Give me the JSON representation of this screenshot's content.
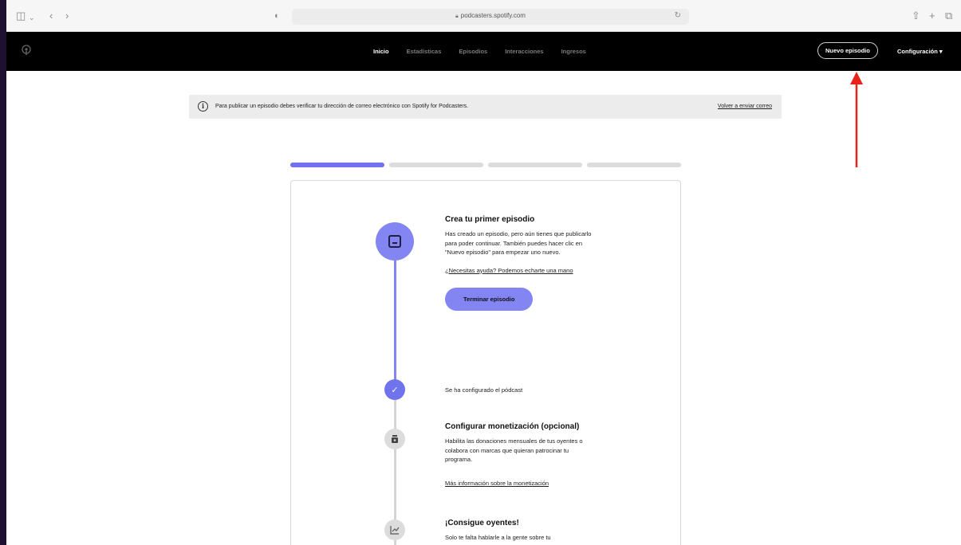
{
  "browser": {
    "url": "podcasters.spotify.com",
    "icons": [
      "sidebar-icon",
      "chevron-down-icon",
      "back-icon",
      "forward-icon",
      "shield-icon",
      "lock-icon",
      "reload-icon",
      "share-icon",
      "new-tab-icon",
      "tabs-icon"
    ]
  },
  "nav": {
    "links": [
      {
        "label": "Inicio",
        "active": true
      },
      {
        "label": "Estadísticas",
        "active": false
      },
      {
        "label": "Episodios",
        "active": false
      },
      {
        "label": "Interacciones",
        "active": false
      },
      {
        "label": "Ingresos",
        "active": false
      }
    ],
    "new_episode": "Nuevo episodio",
    "settings": "Configuración ▾"
  },
  "banner": {
    "text": "Para publicar un episodio debes verificar tu dirección de correo electrónico con Spotify for Podcasters.",
    "link": "Volver a enviar correo"
  },
  "progress": {
    "segments": 4,
    "completed": 1
  },
  "steps": {
    "first_episode": {
      "title": "Crea tu primer episodio",
      "body": "Has creado un episodio, pero aún tienes que publicarlo para poder continuar. También puedes hacer clic en \"Nuevo episodio\" para empezar uno nuevo.",
      "help": "¿Necesitas ayuda? Podemos echarte una mano",
      "cta": "Terminar episodio"
    },
    "configured": {
      "text": "Se ha configurado el pódcast"
    },
    "monetization": {
      "title": "Configurar monetización (opcional)",
      "body": "Habilita las donaciones mensuales de tus oyentes o colabora con marcas que quieran patrocinar tu programa.",
      "link": "Más información sobre la monetización"
    },
    "listeners": {
      "title": "¡Consigue oyentes!",
      "body": "Solo te falta hablarle a la gente sobre tu"
    }
  },
  "colors": {
    "accent": "#8285f2",
    "accent_dark": "#6f74ee",
    "annotation": "#e8231a"
  }
}
